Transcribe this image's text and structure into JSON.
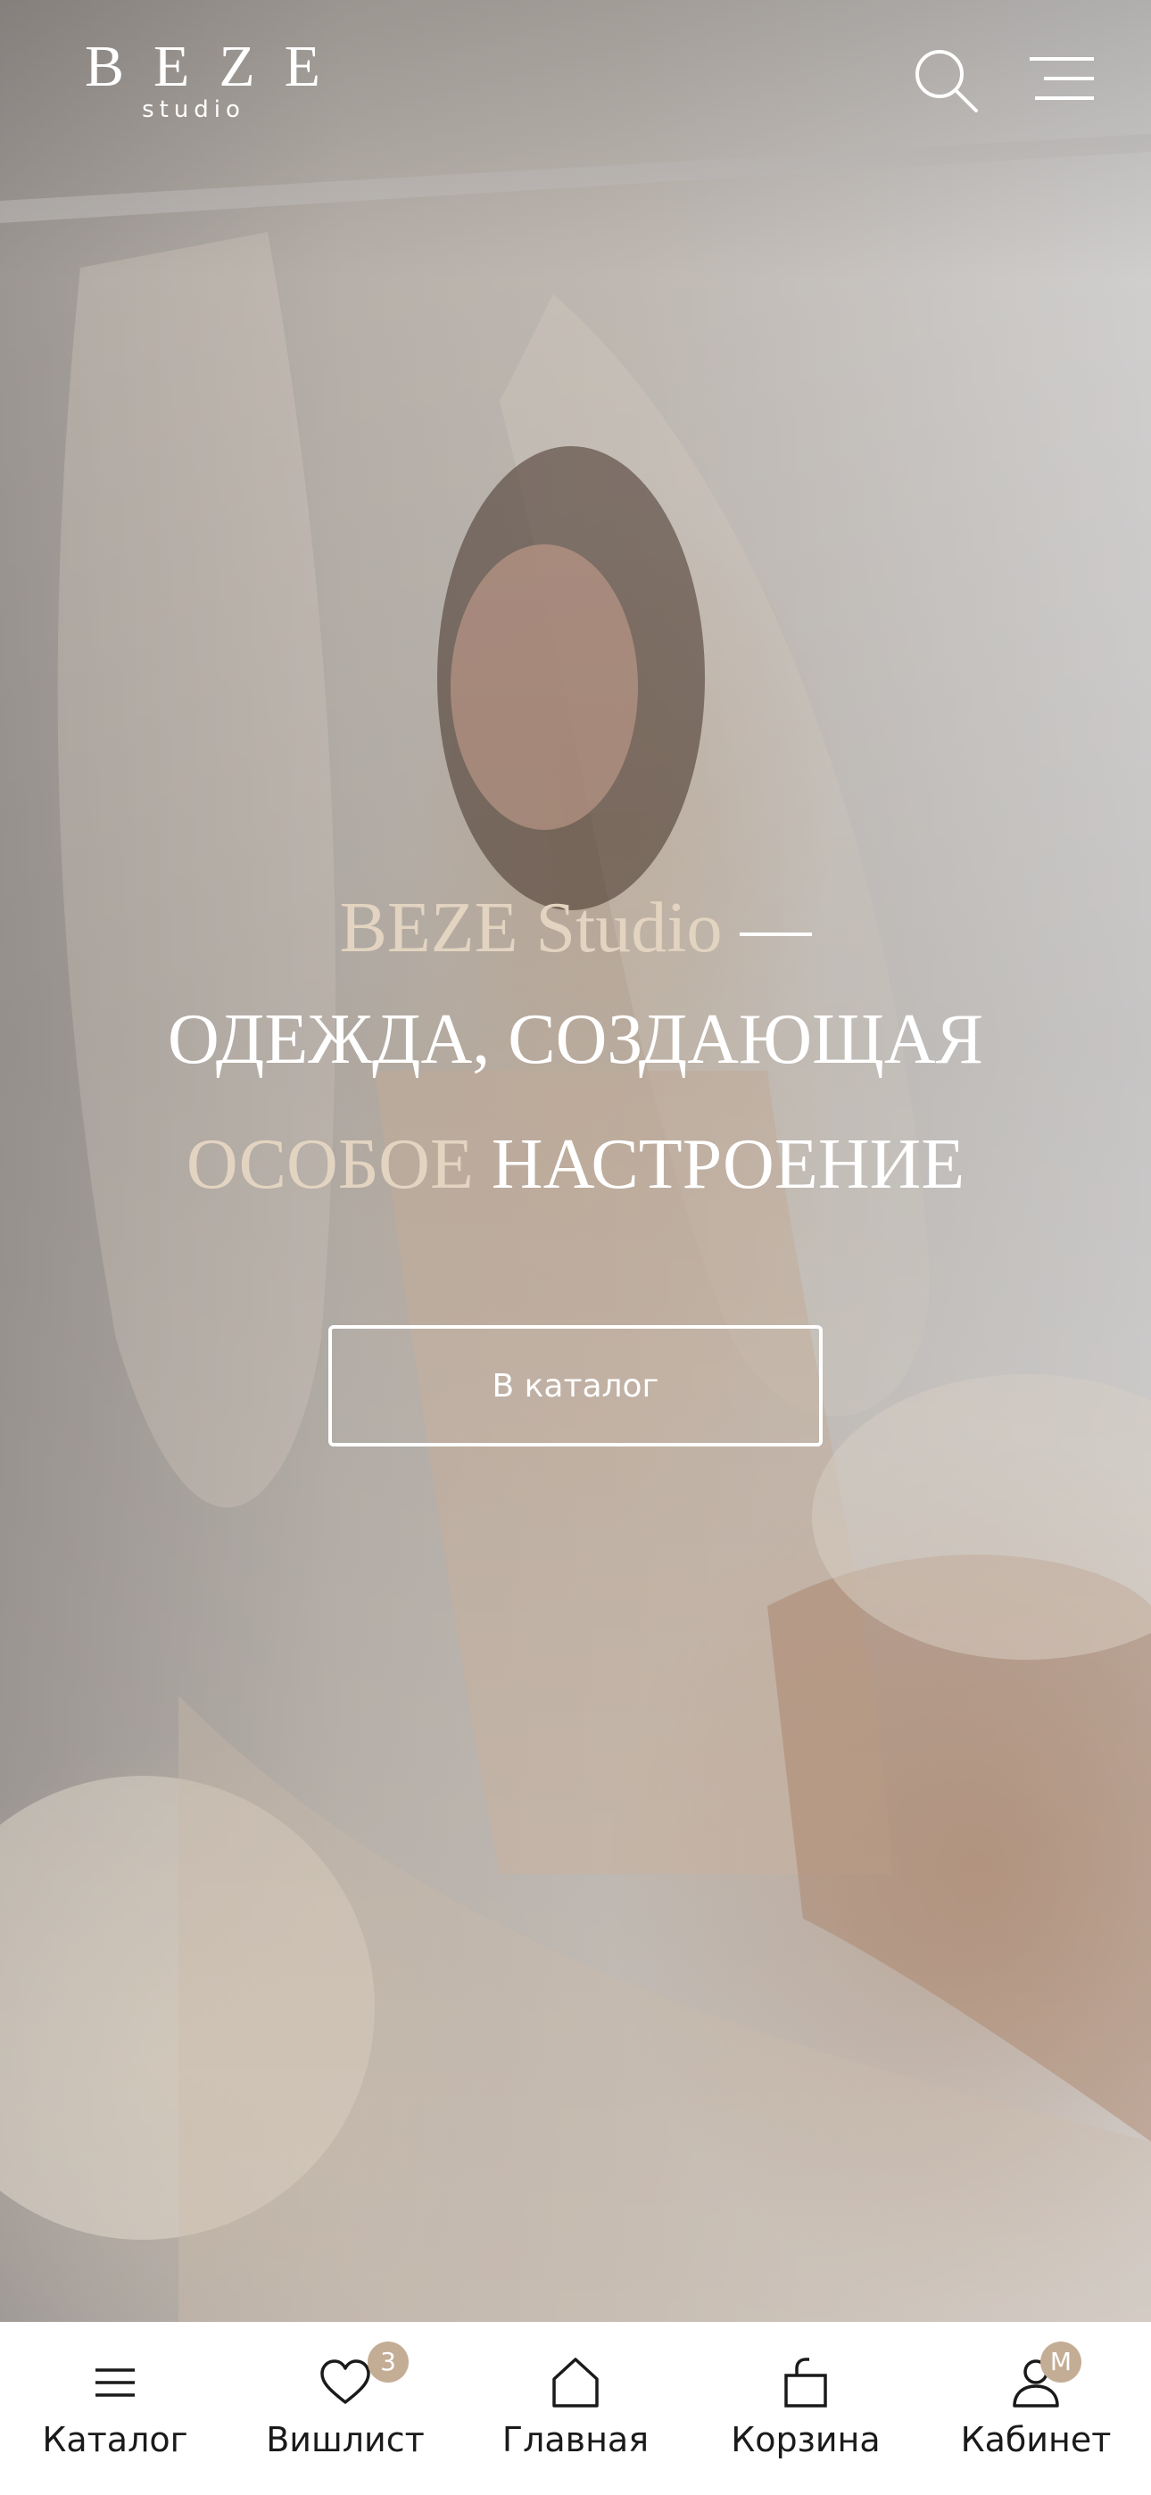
{
  "header": {
    "logo_main": "BEZE",
    "logo_sub": "studio",
    "search_icon": "search-icon",
    "menu_icon": "hamburger-menu-icon"
  },
  "hero": {
    "line1_brand": "BEZE Studio",
    "line1_dash": " —",
    "line2": "ОДЕЖДА, СОЗДАЮЩАЯ",
    "line3_accent": "ОСОБОЕ",
    "line3_white": " НАСТРОЕНИЕ",
    "cta_label": "В каталог"
  },
  "tabbar": {
    "items": [
      {
        "label": "Каталог",
        "icon": "list-icon"
      },
      {
        "label": "Вишлист",
        "icon": "heart-icon",
        "badge": "3"
      },
      {
        "label": "Главная",
        "icon": "home-icon"
      },
      {
        "label": "Корзина",
        "icon": "shopping-bag-icon"
      },
      {
        "label": "Кабинет",
        "icon": "user-icon",
        "badge": "M"
      }
    ]
  },
  "colors": {
    "accent": "#e3d4c1",
    "badge": "#c4ad95",
    "text_dark": "#1a1a1a"
  }
}
